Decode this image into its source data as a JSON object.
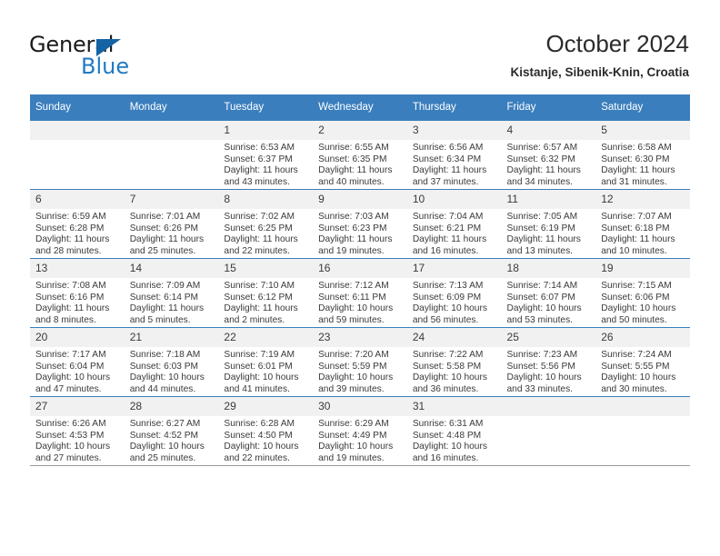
{
  "brand": {
    "name_top": "General",
    "name_bottom": "Blue",
    "accent_color": "#1f7ac4",
    "triangle_color": "#1464a5"
  },
  "header": {
    "title": "October 2024",
    "subtitle": "Kistanje, Sibenik-Knin, Croatia",
    "header_bg": "#3a7ebe",
    "header_text_color": "#ffffff",
    "daynum_bg": "#f1f1f1"
  },
  "weekday_headers": [
    "Sunday",
    "Monday",
    "Tuesday",
    "Wednesday",
    "Thursday",
    "Friday",
    "Saturday"
  ],
  "weeks": [
    {
      "days": [
        {
          "num": "",
          "empty": true,
          "sunrise": "",
          "sunset": "",
          "daylight_line1": "",
          "daylight_line2": ""
        },
        {
          "num": "",
          "empty": true,
          "sunrise": "",
          "sunset": "",
          "daylight_line1": "",
          "daylight_line2": ""
        },
        {
          "num": "1",
          "empty": false,
          "sunrise": "Sunrise: 6:53 AM",
          "sunset": "Sunset: 6:37 PM",
          "daylight_line1": "Daylight: 11 hours",
          "daylight_line2": "and 43 minutes."
        },
        {
          "num": "2",
          "empty": false,
          "sunrise": "Sunrise: 6:55 AM",
          "sunset": "Sunset: 6:35 PM",
          "daylight_line1": "Daylight: 11 hours",
          "daylight_line2": "and 40 minutes."
        },
        {
          "num": "3",
          "empty": false,
          "sunrise": "Sunrise: 6:56 AM",
          "sunset": "Sunset: 6:34 PM",
          "daylight_line1": "Daylight: 11 hours",
          "daylight_line2": "and 37 minutes."
        },
        {
          "num": "4",
          "empty": false,
          "sunrise": "Sunrise: 6:57 AM",
          "sunset": "Sunset: 6:32 PM",
          "daylight_line1": "Daylight: 11 hours",
          "daylight_line2": "and 34 minutes."
        },
        {
          "num": "5",
          "empty": false,
          "sunrise": "Sunrise: 6:58 AM",
          "sunset": "Sunset: 6:30 PM",
          "daylight_line1": "Daylight: 11 hours",
          "daylight_line2": "and 31 minutes."
        }
      ]
    },
    {
      "days": [
        {
          "num": "6",
          "empty": false,
          "sunrise": "Sunrise: 6:59 AM",
          "sunset": "Sunset: 6:28 PM",
          "daylight_line1": "Daylight: 11 hours",
          "daylight_line2": "and 28 minutes."
        },
        {
          "num": "7",
          "empty": false,
          "sunrise": "Sunrise: 7:01 AM",
          "sunset": "Sunset: 6:26 PM",
          "daylight_line1": "Daylight: 11 hours",
          "daylight_line2": "and 25 minutes."
        },
        {
          "num": "8",
          "empty": false,
          "sunrise": "Sunrise: 7:02 AM",
          "sunset": "Sunset: 6:25 PM",
          "daylight_line1": "Daylight: 11 hours",
          "daylight_line2": "and 22 minutes."
        },
        {
          "num": "9",
          "empty": false,
          "sunrise": "Sunrise: 7:03 AM",
          "sunset": "Sunset: 6:23 PM",
          "daylight_line1": "Daylight: 11 hours",
          "daylight_line2": "and 19 minutes."
        },
        {
          "num": "10",
          "empty": false,
          "sunrise": "Sunrise: 7:04 AM",
          "sunset": "Sunset: 6:21 PM",
          "daylight_line1": "Daylight: 11 hours",
          "daylight_line2": "and 16 minutes."
        },
        {
          "num": "11",
          "empty": false,
          "sunrise": "Sunrise: 7:05 AM",
          "sunset": "Sunset: 6:19 PM",
          "daylight_line1": "Daylight: 11 hours",
          "daylight_line2": "and 13 minutes."
        },
        {
          "num": "12",
          "empty": false,
          "sunrise": "Sunrise: 7:07 AM",
          "sunset": "Sunset: 6:18 PM",
          "daylight_line1": "Daylight: 11 hours",
          "daylight_line2": "and 10 minutes."
        }
      ]
    },
    {
      "days": [
        {
          "num": "13",
          "empty": false,
          "sunrise": "Sunrise: 7:08 AM",
          "sunset": "Sunset: 6:16 PM",
          "daylight_line1": "Daylight: 11 hours",
          "daylight_line2": "and 8 minutes."
        },
        {
          "num": "14",
          "empty": false,
          "sunrise": "Sunrise: 7:09 AM",
          "sunset": "Sunset: 6:14 PM",
          "daylight_line1": "Daylight: 11 hours",
          "daylight_line2": "and 5 minutes."
        },
        {
          "num": "15",
          "empty": false,
          "sunrise": "Sunrise: 7:10 AM",
          "sunset": "Sunset: 6:12 PM",
          "daylight_line1": "Daylight: 11 hours",
          "daylight_line2": "and 2 minutes."
        },
        {
          "num": "16",
          "empty": false,
          "sunrise": "Sunrise: 7:12 AM",
          "sunset": "Sunset: 6:11 PM",
          "daylight_line1": "Daylight: 10 hours",
          "daylight_line2": "and 59 minutes."
        },
        {
          "num": "17",
          "empty": false,
          "sunrise": "Sunrise: 7:13 AM",
          "sunset": "Sunset: 6:09 PM",
          "daylight_line1": "Daylight: 10 hours",
          "daylight_line2": "and 56 minutes."
        },
        {
          "num": "18",
          "empty": false,
          "sunrise": "Sunrise: 7:14 AM",
          "sunset": "Sunset: 6:07 PM",
          "daylight_line1": "Daylight: 10 hours",
          "daylight_line2": "and 53 minutes."
        },
        {
          "num": "19",
          "empty": false,
          "sunrise": "Sunrise: 7:15 AM",
          "sunset": "Sunset: 6:06 PM",
          "daylight_line1": "Daylight: 10 hours",
          "daylight_line2": "and 50 minutes."
        }
      ]
    },
    {
      "days": [
        {
          "num": "20",
          "empty": false,
          "sunrise": "Sunrise: 7:17 AM",
          "sunset": "Sunset: 6:04 PM",
          "daylight_line1": "Daylight: 10 hours",
          "daylight_line2": "and 47 minutes."
        },
        {
          "num": "21",
          "empty": false,
          "sunrise": "Sunrise: 7:18 AM",
          "sunset": "Sunset: 6:03 PM",
          "daylight_line1": "Daylight: 10 hours",
          "daylight_line2": "and 44 minutes."
        },
        {
          "num": "22",
          "empty": false,
          "sunrise": "Sunrise: 7:19 AM",
          "sunset": "Sunset: 6:01 PM",
          "daylight_line1": "Daylight: 10 hours",
          "daylight_line2": "and 41 minutes."
        },
        {
          "num": "23",
          "empty": false,
          "sunrise": "Sunrise: 7:20 AM",
          "sunset": "Sunset: 5:59 PM",
          "daylight_line1": "Daylight: 10 hours",
          "daylight_line2": "and 39 minutes."
        },
        {
          "num": "24",
          "empty": false,
          "sunrise": "Sunrise: 7:22 AM",
          "sunset": "Sunset: 5:58 PM",
          "daylight_line1": "Daylight: 10 hours",
          "daylight_line2": "and 36 minutes."
        },
        {
          "num": "25",
          "empty": false,
          "sunrise": "Sunrise: 7:23 AM",
          "sunset": "Sunset: 5:56 PM",
          "daylight_line1": "Daylight: 10 hours",
          "daylight_line2": "and 33 minutes."
        },
        {
          "num": "26",
          "empty": false,
          "sunrise": "Sunrise: 7:24 AM",
          "sunset": "Sunset: 5:55 PM",
          "daylight_line1": "Daylight: 10 hours",
          "daylight_line2": "and 30 minutes."
        }
      ]
    },
    {
      "days": [
        {
          "num": "27",
          "empty": false,
          "sunrise": "Sunrise: 6:26 AM",
          "sunset": "Sunset: 4:53 PM",
          "daylight_line1": "Daylight: 10 hours",
          "daylight_line2": "and 27 minutes."
        },
        {
          "num": "28",
          "empty": false,
          "sunrise": "Sunrise: 6:27 AM",
          "sunset": "Sunset: 4:52 PM",
          "daylight_line1": "Daylight: 10 hours",
          "daylight_line2": "and 25 minutes."
        },
        {
          "num": "29",
          "empty": false,
          "sunrise": "Sunrise: 6:28 AM",
          "sunset": "Sunset: 4:50 PM",
          "daylight_line1": "Daylight: 10 hours",
          "daylight_line2": "and 22 minutes."
        },
        {
          "num": "30",
          "empty": false,
          "sunrise": "Sunrise: 6:29 AM",
          "sunset": "Sunset: 4:49 PM",
          "daylight_line1": "Daylight: 10 hours",
          "daylight_line2": "and 19 minutes."
        },
        {
          "num": "31",
          "empty": false,
          "sunrise": "Sunrise: 6:31 AM",
          "sunset": "Sunset: 4:48 PM",
          "daylight_line1": "Daylight: 10 hours",
          "daylight_line2": "and 16 minutes."
        },
        {
          "num": "",
          "empty": true,
          "sunrise": "",
          "sunset": "",
          "daylight_line1": "",
          "daylight_line2": ""
        },
        {
          "num": "",
          "empty": true,
          "sunrise": "",
          "sunset": "",
          "daylight_line1": "",
          "daylight_line2": ""
        }
      ]
    }
  ]
}
